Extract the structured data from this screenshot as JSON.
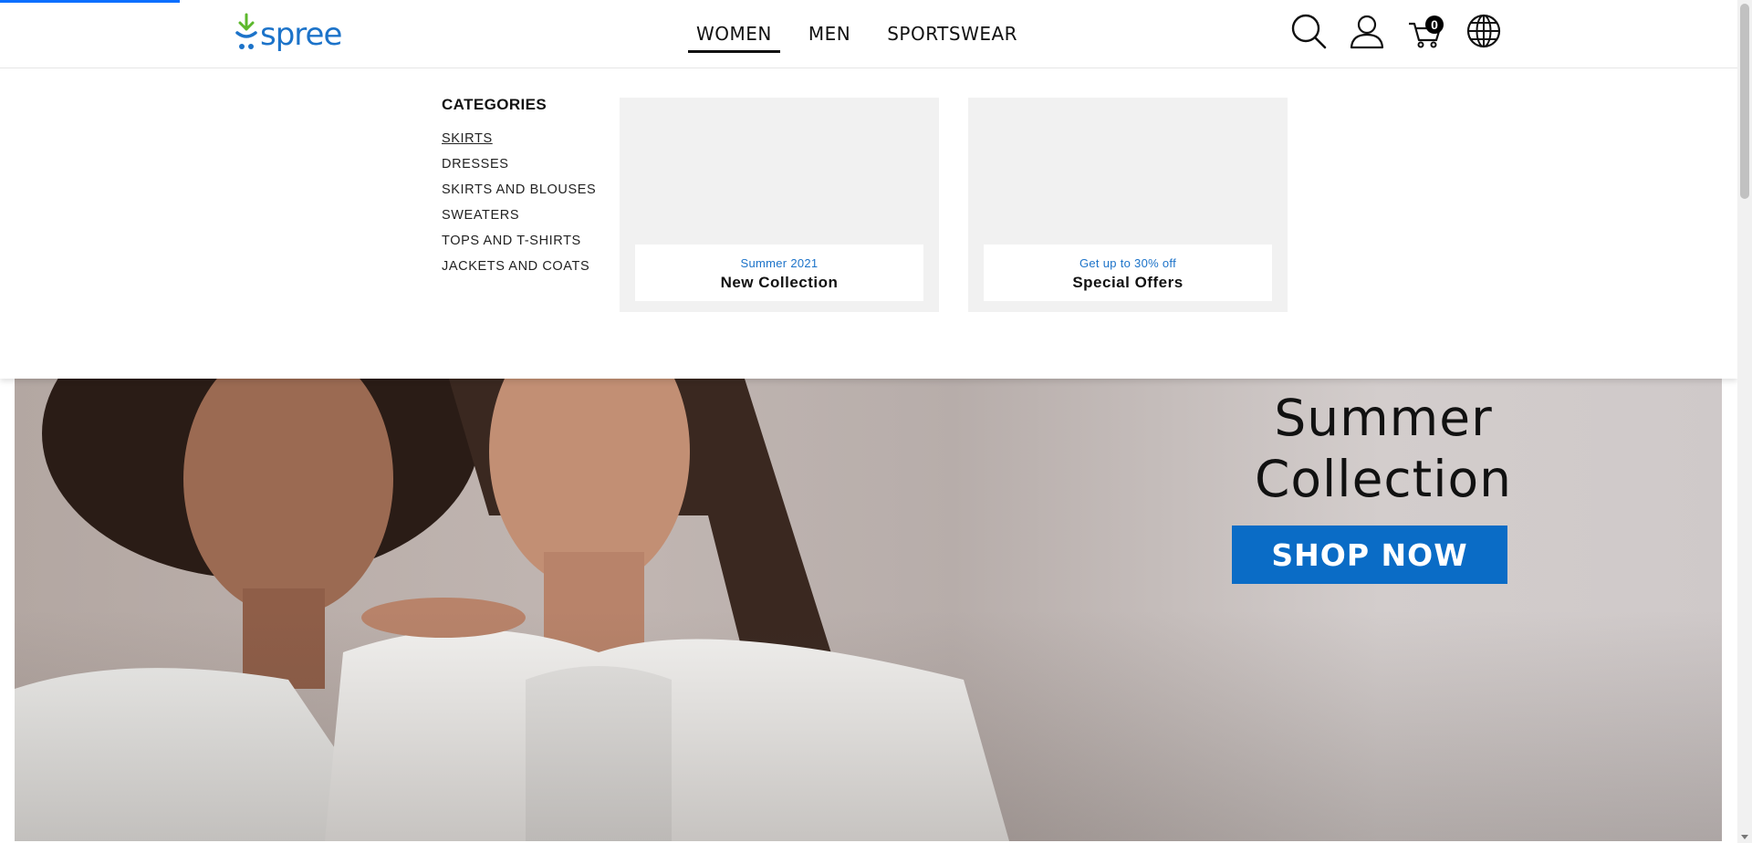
{
  "brand": {
    "name": "spree",
    "color": "#1c73c9",
    "accent_green": "#5cb82c"
  },
  "nav": {
    "items": [
      {
        "label": "WOMEN",
        "active": true
      },
      {
        "label": "MEN",
        "active": false
      },
      {
        "label": "SPORTSWEAR",
        "active": false
      }
    ]
  },
  "header_icons": {
    "search": "search-icon",
    "account": "user-icon",
    "cart": "cart-icon",
    "cart_count": "0",
    "language": "globe-icon"
  },
  "dropdown": {
    "categories_title": "CATEGORIES",
    "categories": [
      "SKIRTS",
      "DRESSES",
      "SKIRTS AND BLOUSES",
      "SWEATERS",
      "TOPS AND T-SHIRTS",
      "JACKETS AND COATS"
    ],
    "promos": [
      {
        "subtitle": "Summer 2021",
        "title": "New Collection"
      },
      {
        "subtitle": "Get up to 30% off",
        "title": "Special Offers"
      }
    ]
  },
  "hero": {
    "title_line1": "Summer",
    "title_line2": "Collection",
    "button_label": "SHOP NOW",
    "button_color": "#0a6cc6"
  }
}
